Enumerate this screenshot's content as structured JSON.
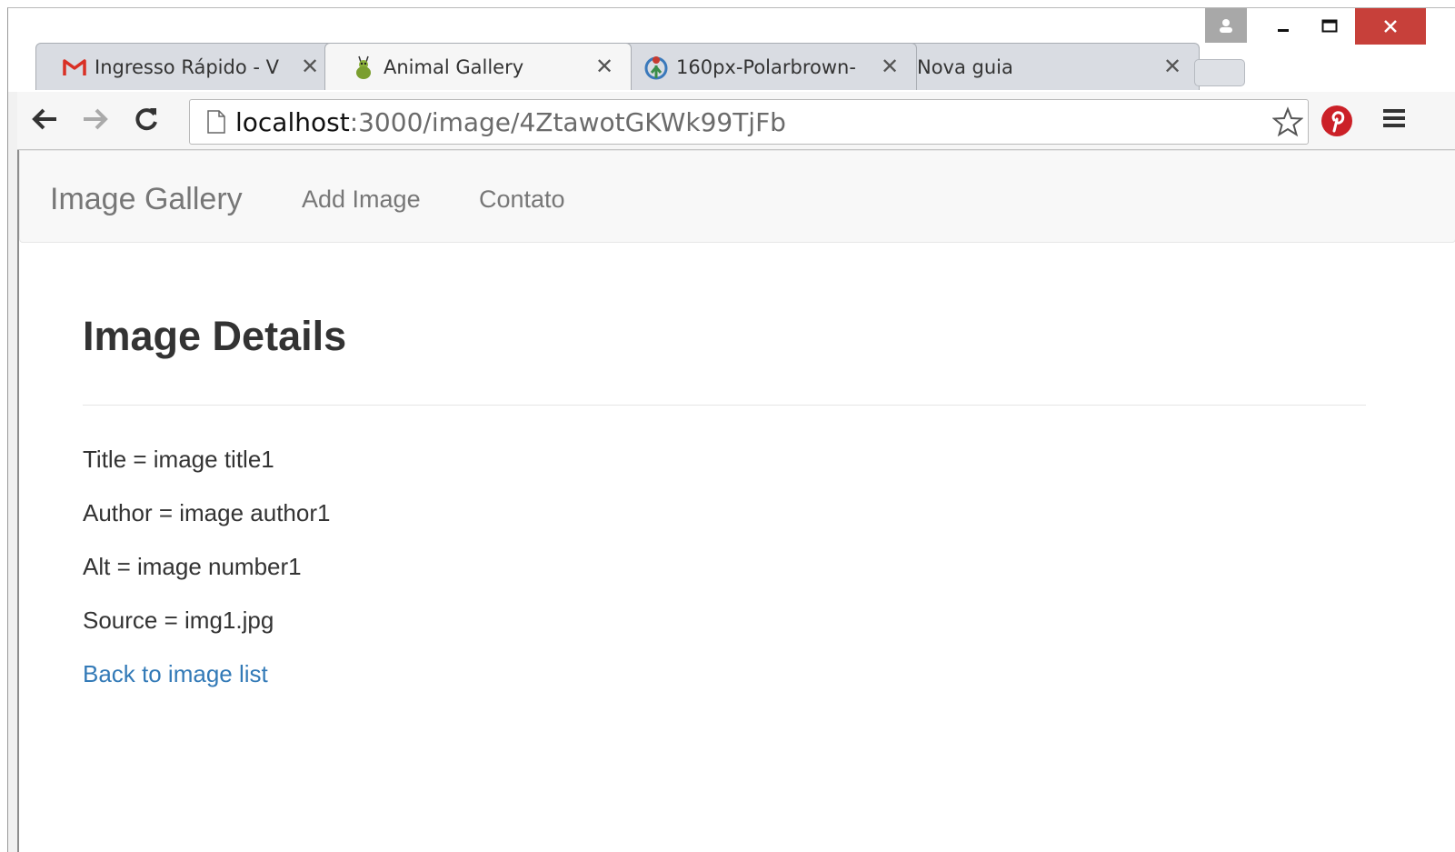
{
  "browser": {
    "tabs": [
      {
        "label": "Ingresso Rápido - V",
        "icon": "gmail-icon",
        "active": false
      },
      {
        "label": "Animal Gallery",
        "icon": "bug-favicon",
        "active": true
      },
      {
        "label": "160px-Polarbrown-",
        "icon": "wikimedia-icon",
        "active": false
      },
      {
        "label": "Nova guia",
        "icon": "",
        "active": false
      }
    ],
    "url_host": "localhost",
    "url_path": ":3000/image/4ZtawotGKWk99TjFb",
    "colors": {
      "close_button": "#c7403a",
      "pinterest": "#cb2027",
      "link": "#337ab7"
    }
  },
  "navbar": {
    "brand": "Image Gallery",
    "links": [
      "Add Image",
      "Contato"
    ]
  },
  "page": {
    "title": "Image Details",
    "details": [
      "Title = image title1",
      "Author = image author1",
      "Alt = image number1",
      "Source = img1.jpg"
    ],
    "back_link": "Back to image list"
  }
}
